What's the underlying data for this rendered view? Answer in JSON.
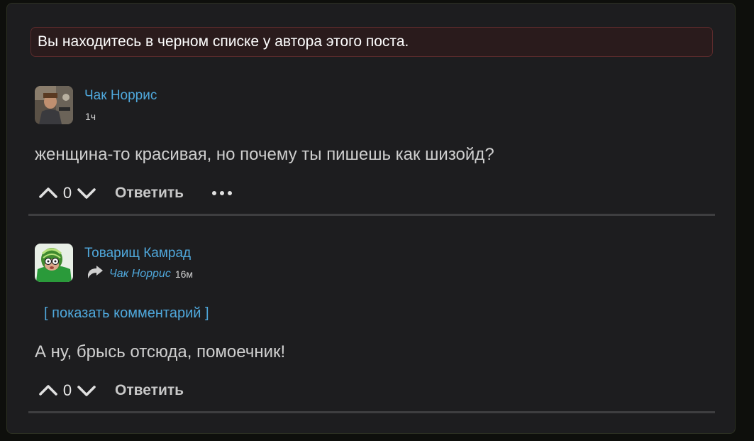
{
  "notice": {
    "text": "Вы находитесь в черном списке у автора этого поста."
  },
  "comments": [
    {
      "author": "Чак Норрис",
      "time": "1ч",
      "avatar_icon": "user-photo-avatar",
      "text": "женщина-то красивая, но почему ты пишешь как шизойд?",
      "score": "0",
      "reply_label": "Ответить",
      "more_icon": "ellipsis-icon"
    },
    {
      "author": "Товарищ Камрад",
      "reply_to": {
        "icon": "reply-arrow-icon",
        "name": "Чак Норрис",
        "time": "16м"
      },
      "avatar_icon": "user-photo-avatar",
      "show_comment_label": "[ показать комментарий ]",
      "text": "А ну, брысь отсюда, помоечник!",
      "score": "0",
      "reply_label": "Ответить"
    }
  ],
  "colors": {
    "background": "#0e0f0c",
    "panel": "#1d1d1f",
    "link": "#4fa8dc",
    "notice_bg": "#2a1b1c",
    "notice_border": "#5b2b2c",
    "divider": "#3e3e40"
  }
}
